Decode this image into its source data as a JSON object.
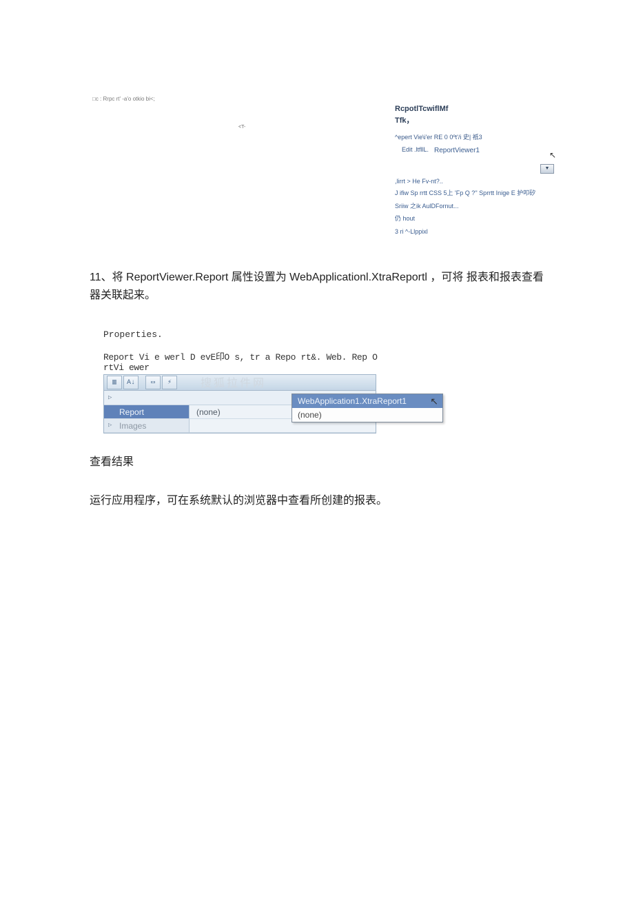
{
  "top_figure": {
    "line1": "□c :  Rrpc rt' -a'o otkio bi<;",
    "line2": "<T-"
  },
  "smarttag": {
    "title1": "RcpotlTcwiflMf",
    "title2": "Tfk，",
    "select_label": "^epert Vie\\i'er RE 0 0ºt'/i 史| 祇3",
    "select_value": "ReportViewer1",
    "edit_label": "Edit .ltfllL.",
    "link1": ",lirrt > He Fv-nt?..",
    "chk1": "J ifiw Sp rrtt CSS 5上 'Fp Q ?'' Sprrtt Inige E 护叩矽",
    "link2": "Sriiw 之ik AulDFornut...",
    "link3": "仍  hout",
    "link4": "3 ri ^-Llppixl"
  },
  "paragraph11": "11、将 ReportViewer.Report 属性设置为 WebApplicationl.XtraReportl ，可将 报表和报表查看器关联起来。",
  "properties": {
    "title": "Properties.",
    "subtitle": "Report Vi e werl D evE印O s, tr a Repo rt&. Web. Rep O rtVi ewer",
    "row_report_key": "Report",
    "row_report_val": "(none)",
    "row_images_key": "Images",
    "dropdown_opt1": "WebApplication1.XtraReport1",
    "dropdown_opt2": "(none)"
  },
  "result_heading": "查看结果",
  "result_para": "运行应用程序，可在系统默认的浏览器中查看所创建的报表。"
}
